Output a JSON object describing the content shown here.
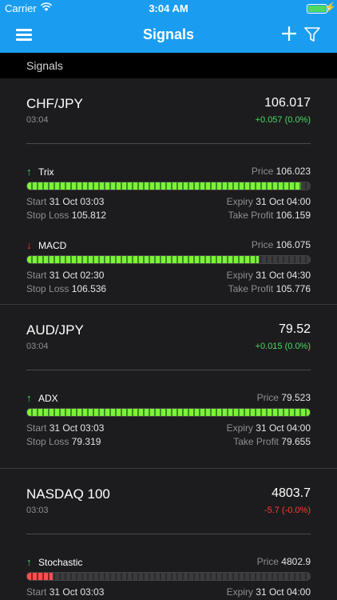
{
  "status": {
    "carrier": "Carrier",
    "time": "3:04 AM",
    "battery_level": 1.0
  },
  "nav": {
    "title": "Signals",
    "icons": {
      "menu": "hamburger-menu-icon",
      "add": "plus-icon",
      "filter": "filter-icon"
    }
  },
  "section": {
    "title": "Signals"
  },
  "instruments": [
    {
      "name": "CHF/JPY",
      "time": "03:04",
      "price": "106.017",
      "change": "+0.057 (0.0%)",
      "change_dir": "up",
      "signals": [
        {
          "name": "Trix",
          "direction": "up",
          "price_label": "Price",
          "price": "106.023",
          "strength": 0.97,
          "start_label": "Start",
          "start": "31 Oct 03:03",
          "expiry_label": "Expiry",
          "expiry": "31 Oct 04:00",
          "sl_label": "Stop Loss",
          "sl": "105.812",
          "tp_label": "Take Profit",
          "tp": "106.159"
        },
        {
          "name": "MACD",
          "direction": "down",
          "price_label": "Price",
          "price": "106.075",
          "strength": 0.82,
          "start_label": "Start",
          "start": "31 Oct 02:30",
          "expiry_label": "Expiry",
          "expiry": "31 Oct 04:30",
          "sl_label": "Stop Loss",
          "sl": "106.536",
          "tp_label": "Take Profit",
          "tp": "105.776"
        }
      ]
    },
    {
      "name": "AUD/JPY",
      "time": "03:04",
      "price": "79.52",
      "change": "+0.015 (0.0%)",
      "change_dir": "up",
      "signals": [
        {
          "name": "ADX",
          "direction": "up",
          "price_label": "Price",
          "price": "79.523",
          "strength": 1.0,
          "start_label": "Start",
          "start": "31 Oct 03:03",
          "expiry_label": "Expiry",
          "expiry": "31 Oct 04:00",
          "sl_label": "Stop Loss",
          "sl": "79.319",
          "tp_label": "Take Profit",
          "tp": "79.655"
        }
      ]
    },
    {
      "name": "NASDAQ 100",
      "time": "03:03",
      "price": "4803.7",
      "change": "-5.7 (-0.0%)",
      "change_dir": "down",
      "signals": [
        {
          "name": "Stochastic",
          "direction": "up",
          "price_label": "Price",
          "price": "4802.9",
          "strength": 0.09,
          "start_label": "Start",
          "start": "31 Oct 03:03",
          "expiry_label": "Expiry",
          "expiry": "31 Oct 04:00"
        }
      ]
    }
  ],
  "colors": {
    "accent": "#1a9df0",
    "positive": "#4cd964",
    "negative": "#ff3b30",
    "bar_green": "#7cf23a",
    "bar_red": "#ff4d4d"
  }
}
